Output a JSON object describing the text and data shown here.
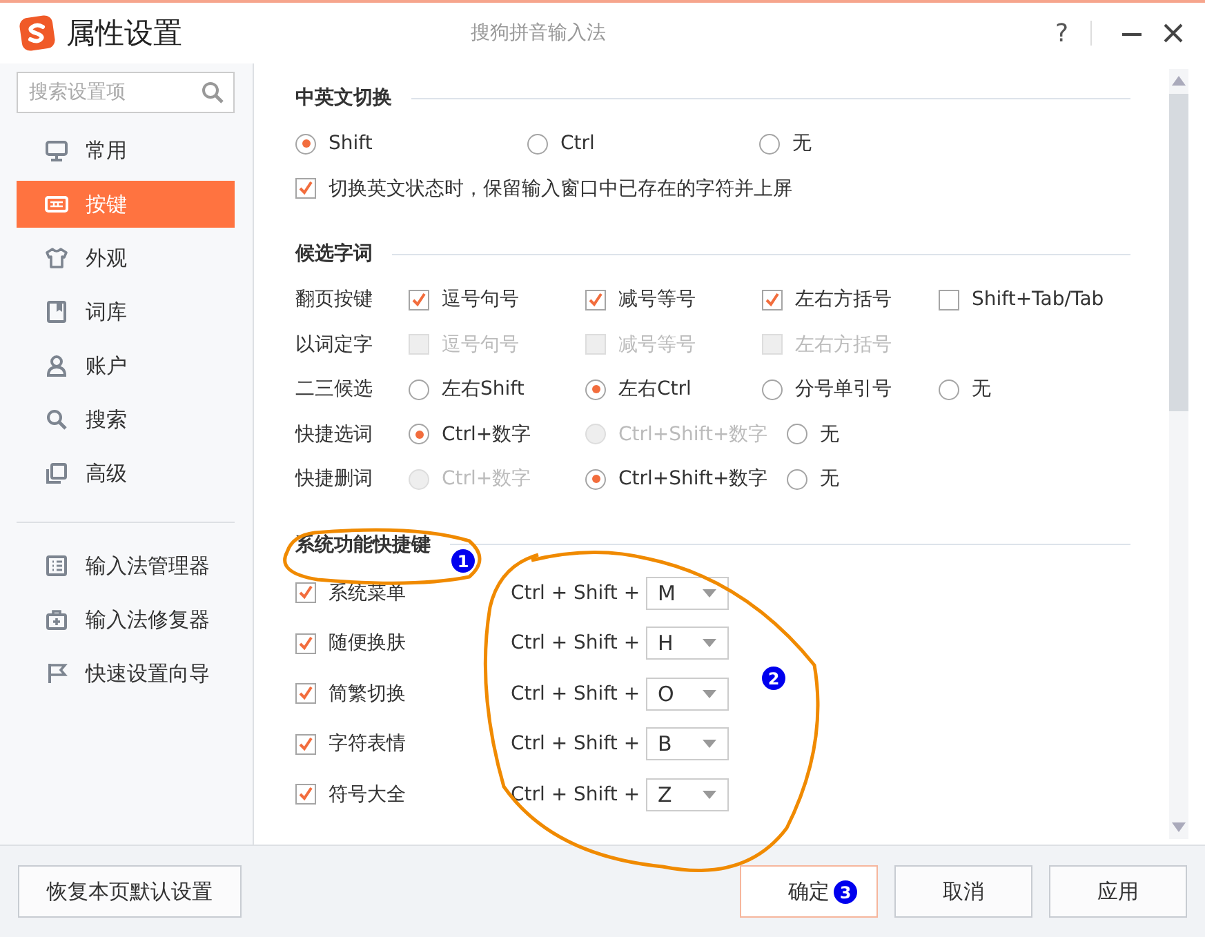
{
  "window": {
    "title": "属性设置",
    "app_name": "搜狗拼音输入法",
    "help": "?"
  },
  "sidebar": {
    "search": {
      "placeholder": "搜索设置项"
    },
    "items": [
      {
        "label": "常用",
        "selected": false
      },
      {
        "label": "按键",
        "selected": true
      },
      {
        "label": "外观",
        "selected": false
      },
      {
        "label": "词库",
        "selected": false
      },
      {
        "label": "账户",
        "selected": false
      },
      {
        "label": "搜索",
        "selected": false
      },
      {
        "label": "高级",
        "selected": false
      }
    ],
    "tools": [
      {
        "label": "输入法管理器"
      },
      {
        "label": "输入法修复器"
      },
      {
        "label": "快速设置向导"
      }
    ]
  },
  "sections": [
    {
      "title": "中英文切换",
      "kind": "switch",
      "rows": [
        {
          "items": [
            {
              "kind": "radio",
              "label": "Shift",
              "selected": true
            },
            {
              "kind": "radio",
              "label": "Ctrl",
              "selected": false
            },
            {
              "kind": "radio",
              "label": "无",
              "selected": false
            }
          ]
        },
        {
          "items": [
            {
              "kind": "checkbox",
              "label": "切换英文状态时，保留输入窗口中已存在的字符并上屏",
              "checked": true
            }
          ]
        }
      ]
    },
    {
      "title": "候选字词",
      "kind": "grid",
      "rows": [
        {
          "label": "翻页按键",
          "items": [
            {
              "kind": "checkbox",
              "label": "逗号句号",
              "checked": true,
              "disabled": false
            },
            {
              "kind": "checkbox",
              "label": "减号等号",
              "checked": true,
              "disabled": false
            },
            {
              "kind": "checkbox",
              "label": "左右方括号",
              "checked": true,
              "disabled": false
            },
            {
              "kind": "checkbox",
              "label": "Shift+Tab/Tab",
              "checked": false,
              "disabled": false
            }
          ]
        },
        {
          "label": "以词定字",
          "items": [
            {
              "kind": "checkbox",
              "label": "逗号句号",
              "checked": false,
              "disabled": true
            },
            {
              "kind": "checkbox",
              "label": "减号等号",
              "checked": false,
              "disabled": true
            },
            {
              "kind": "checkbox",
              "label": "左右方括号",
              "checked": false,
              "disabled": true
            }
          ]
        },
        {
          "label": "二三候选",
          "items": [
            {
              "kind": "radio",
              "label": "左右Shift",
              "selected": false,
              "disabled": false
            },
            {
              "kind": "radio",
              "label": "左右Ctrl",
              "selected": true,
              "disabled": false
            },
            {
              "kind": "radio",
              "label": "分号单引号",
              "selected": false,
              "disabled": false
            },
            {
              "kind": "radio",
              "label": "无",
              "selected": false,
              "disabled": false
            }
          ]
        },
        {
          "label": "快捷选词",
          "items": [
            {
              "kind": "radio",
              "label": "Ctrl+数字",
              "selected": true,
              "disabled": false
            },
            {
              "kind": "radio",
              "label": "Ctrl+Shift+数字",
              "selected": false,
              "disabled": true
            },
            {
              "kind": "radio",
              "label": "无",
              "selected": false,
              "disabled": false
            }
          ]
        },
        {
          "label": "快捷删词",
          "items": [
            {
              "kind": "radio",
              "label": "Ctrl+数字",
              "selected": false,
              "disabled": true
            },
            {
              "kind": "radio",
              "label": "Ctrl+Shift+数字",
              "selected": true,
              "disabled": false
            },
            {
              "kind": "radio",
              "label": "无",
              "selected": false,
              "disabled": false
            }
          ]
        }
      ]
    },
    {
      "title": "系统功能快捷键",
      "kind": "hotkeys",
      "rows": [
        {
          "label": "系统菜单",
          "checked": true,
          "prefix": "Ctrl + Shift +",
          "key": "M"
        },
        {
          "label": "随便换肤",
          "checked": true,
          "prefix": "Ctrl + Shift +",
          "key": "H"
        },
        {
          "label": "简繁切换",
          "checked": true,
          "prefix": "Ctrl + Shift +",
          "key": "O"
        },
        {
          "label": "字符表情",
          "checked": true,
          "prefix": "Ctrl + Shift +",
          "key": "B"
        },
        {
          "label": "符号大全",
          "checked": true,
          "prefix": "Ctrl + Shift +",
          "key": "Z"
        }
      ]
    }
  ],
  "footer": {
    "reset": "恢复本页默认设置",
    "buttons": [
      {
        "label": "确定",
        "kind": "primary"
      },
      {
        "label": "取消",
        "kind": "normal"
      },
      {
        "label": "应用",
        "kind": "normal"
      }
    ]
  },
  "annotations": [
    {
      "label": "1"
    },
    {
      "label": "2"
    },
    {
      "label": "3"
    }
  ]
}
